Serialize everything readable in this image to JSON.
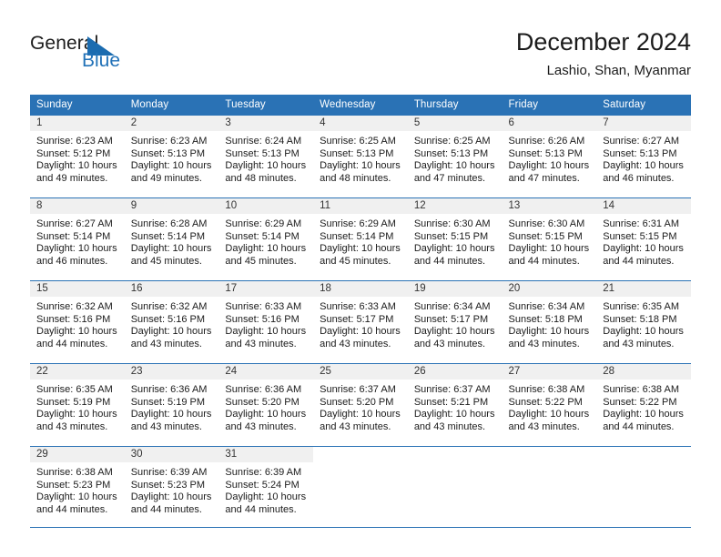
{
  "logo": {
    "word1": "General",
    "word2": "Blue",
    "triangle_color": "#1b6cb0",
    "word2_color": "#2272b8"
  },
  "header": {
    "title": "December 2024",
    "subtitle": "Lashio, Shan, Myanmar"
  },
  "theme": {
    "header_bg": "#2a72b5",
    "daynum_bg": "#f0f0f0",
    "text": "#1b1b1b"
  },
  "calendar": {
    "weekdays": [
      "Sunday",
      "Monday",
      "Tuesday",
      "Wednesday",
      "Thursday",
      "Friday",
      "Saturday"
    ],
    "weeks": [
      [
        {
          "day": "1",
          "sunrise": "Sunrise: 6:23 AM",
          "sunset": "Sunset: 5:12 PM",
          "daylight1": "Daylight: 10 hours",
          "daylight2": "and 49 minutes."
        },
        {
          "day": "2",
          "sunrise": "Sunrise: 6:23 AM",
          "sunset": "Sunset: 5:13 PM",
          "daylight1": "Daylight: 10 hours",
          "daylight2": "and 49 minutes."
        },
        {
          "day": "3",
          "sunrise": "Sunrise: 6:24 AM",
          "sunset": "Sunset: 5:13 PM",
          "daylight1": "Daylight: 10 hours",
          "daylight2": "and 48 minutes."
        },
        {
          "day": "4",
          "sunrise": "Sunrise: 6:25 AM",
          "sunset": "Sunset: 5:13 PM",
          "daylight1": "Daylight: 10 hours",
          "daylight2": "and 48 minutes."
        },
        {
          "day": "5",
          "sunrise": "Sunrise: 6:25 AM",
          "sunset": "Sunset: 5:13 PM",
          "daylight1": "Daylight: 10 hours",
          "daylight2": "and 47 minutes."
        },
        {
          "day": "6",
          "sunrise": "Sunrise: 6:26 AM",
          "sunset": "Sunset: 5:13 PM",
          "daylight1": "Daylight: 10 hours",
          "daylight2": "and 47 minutes."
        },
        {
          "day": "7",
          "sunrise": "Sunrise: 6:27 AM",
          "sunset": "Sunset: 5:13 PM",
          "daylight1": "Daylight: 10 hours",
          "daylight2": "and 46 minutes."
        }
      ],
      [
        {
          "day": "8",
          "sunrise": "Sunrise: 6:27 AM",
          "sunset": "Sunset: 5:14 PM",
          "daylight1": "Daylight: 10 hours",
          "daylight2": "and 46 minutes."
        },
        {
          "day": "9",
          "sunrise": "Sunrise: 6:28 AM",
          "sunset": "Sunset: 5:14 PM",
          "daylight1": "Daylight: 10 hours",
          "daylight2": "and 45 minutes."
        },
        {
          "day": "10",
          "sunrise": "Sunrise: 6:29 AM",
          "sunset": "Sunset: 5:14 PM",
          "daylight1": "Daylight: 10 hours",
          "daylight2": "and 45 minutes."
        },
        {
          "day": "11",
          "sunrise": "Sunrise: 6:29 AM",
          "sunset": "Sunset: 5:14 PM",
          "daylight1": "Daylight: 10 hours",
          "daylight2": "and 45 minutes."
        },
        {
          "day": "12",
          "sunrise": "Sunrise: 6:30 AM",
          "sunset": "Sunset: 5:15 PM",
          "daylight1": "Daylight: 10 hours",
          "daylight2": "and 44 minutes."
        },
        {
          "day": "13",
          "sunrise": "Sunrise: 6:30 AM",
          "sunset": "Sunset: 5:15 PM",
          "daylight1": "Daylight: 10 hours",
          "daylight2": "and 44 minutes."
        },
        {
          "day": "14",
          "sunrise": "Sunrise: 6:31 AM",
          "sunset": "Sunset: 5:15 PM",
          "daylight1": "Daylight: 10 hours",
          "daylight2": "and 44 minutes."
        }
      ],
      [
        {
          "day": "15",
          "sunrise": "Sunrise: 6:32 AM",
          "sunset": "Sunset: 5:16 PM",
          "daylight1": "Daylight: 10 hours",
          "daylight2": "and 44 minutes."
        },
        {
          "day": "16",
          "sunrise": "Sunrise: 6:32 AM",
          "sunset": "Sunset: 5:16 PM",
          "daylight1": "Daylight: 10 hours",
          "daylight2": "and 43 minutes."
        },
        {
          "day": "17",
          "sunrise": "Sunrise: 6:33 AM",
          "sunset": "Sunset: 5:16 PM",
          "daylight1": "Daylight: 10 hours",
          "daylight2": "and 43 minutes."
        },
        {
          "day": "18",
          "sunrise": "Sunrise: 6:33 AM",
          "sunset": "Sunset: 5:17 PM",
          "daylight1": "Daylight: 10 hours",
          "daylight2": "and 43 minutes."
        },
        {
          "day": "19",
          "sunrise": "Sunrise: 6:34 AM",
          "sunset": "Sunset: 5:17 PM",
          "daylight1": "Daylight: 10 hours",
          "daylight2": "and 43 minutes."
        },
        {
          "day": "20",
          "sunrise": "Sunrise: 6:34 AM",
          "sunset": "Sunset: 5:18 PM",
          "daylight1": "Daylight: 10 hours",
          "daylight2": "and 43 minutes."
        },
        {
          "day": "21",
          "sunrise": "Sunrise: 6:35 AM",
          "sunset": "Sunset: 5:18 PM",
          "daylight1": "Daylight: 10 hours",
          "daylight2": "and 43 minutes."
        }
      ],
      [
        {
          "day": "22",
          "sunrise": "Sunrise: 6:35 AM",
          "sunset": "Sunset: 5:19 PM",
          "daylight1": "Daylight: 10 hours",
          "daylight2": "and 43 minutes."
        },
        {
          "day": "23",
          "sunrise": "Sunrise: 6:36 AM",
          "sunset": "Sunset: 5:19 PM",
          "daylight1": "Daylight: 10 hours",
          "daylight2": "and 43 minutes."
        },
        {
          "day": "24",
          "sunrise": "Sunrise: 6:36 AM",
          "sunset": "Sunset: 5:20 PM",
          "daylight1": "Daylight: 10 hours",
          "daylight2": "and 43 minutes."
        },
        {
          "day": "25",
          "sunrise": "Sunrise: 6:37 AM",
          "sunset": "Sunset: 5:20 PM",
          "daylight1": "Daylight: 10 hours",
          "daylight2": "and 43 minutes."
        },
        {
          "day": "26",
          "sunrise": "Sunrise: 6:37 AM",
          "sunset": "Sunset: 5:21 PM",
          "daylight1": "Daylight: 10 hours",
          "daylight2": "and 43 minutes."
        },
        {
          "day": "27",
          "sunrise": "Sunrise: 6:38 AM",
          "sunset": "Sunset: 5:22 PM",
          "daylight1": "Daylight: 10 hours",
          "daylight2": "and 43 minutes."
        },
        {
          "day": "28",
          "sunrise": "Sunrise: 6:38 AM",
          "sunset": "Sunset: 5:22 PM",
          "daylight1": "Daylight: 10 hours",
          "daylight2": "and 44 minutes."
        }
      ],
      [
        {
          "day": "29",
          "sunrise": "Sunrise: 6:38 AM",
          "sunset": "Sunset: 5:23 PM",
          "daylight1": "Daylight: 10 hours",
          "daylight2": "and 44 minutes."
        },
        {
          "day": "30",
          "sunrise": "Sunrise: 6:39 AM",
          "sunset": "Sunset: 5:23 PM",
          "daylight1": "Daylight: 10 hours",
          "daylight2": "and 44 minutes."
        },
        {
          "day": "31",
          "sunrise": "Sunrise: 6:39 AM",
          "sunset": "Sunset: 5:24 PM",
          "daylight1": "Daylight: 10 hours",
          "daylight2": "and 44 minutes."
        },
        {
          "day": "",
          "sunrise": "",
          "sunset": "",
          "daylight1": "",
          "daylight2": ""
        },
        {
          "day": "",
          "sunrise": "",
          "sunset": "",
          "daylight1": "",
          "daylight2": ""
        },
        {
          "day": "",
          "sunrise": "",
          "sunset": "",
          "daylight1": "",
          "daylight2": ""
        },
        {
          "day": "",
          "sunrise": "",
          "sunset": "",
          "daylight1": "",
          "daylight2": ""
        }
      ]
    ]
  }
}
